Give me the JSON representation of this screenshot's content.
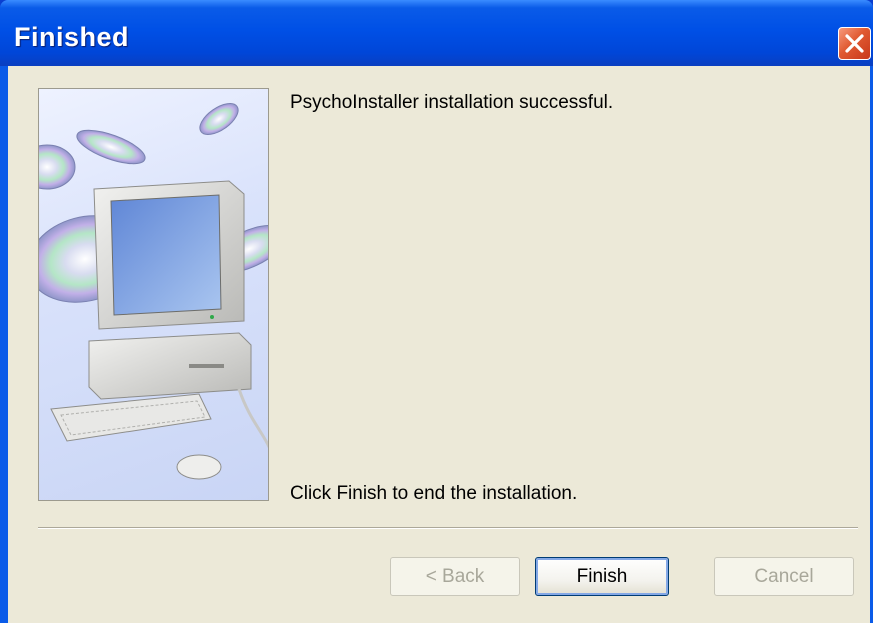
{
  "window": {
    "title": "Finished"
  },
  "messages": {
    "success": "PsychoInstaller installation successful.",
    "instruction": "Click Finish to end the installation."
  },
  "buttons": {
    "back": "< Back",
    "finish": "Finish",
    "cancel": "Cancel"
  },
  "colors": {
    "titlebar": "#0050e6",
    "client_background": "#ece9d8",
    "close_button": "#e05a32"
  }
}
